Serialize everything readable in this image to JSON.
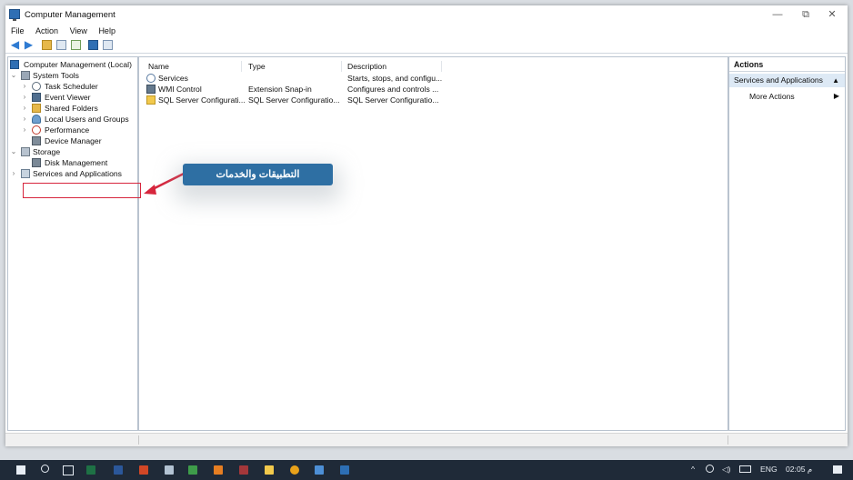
{
  "window": {
    "title": "Computer Management",
    "minimize": "—",
    "restore": "⧉",
    "close": "✕"
  },
  "menu": [
    "File",
    "Action",
    "View",
    "Help"
  ],
  "tree": {
    "root": "Computer Management (Local)",
    "items": [
      "System Tools",
      "Task Scheduler",
      "Event Viewer",
      "Shared Folders",
      "Local Users and Groups",
      "Performance",
      "Device Manager",
      "Storage",
      "Disk Management",
      "Services and Applications"
    ]
  },
  "list": {
    "columns": [
      "Name",
      "Type",
      "Description"
    ],
    "rows": [
      {
        "name": "Services",
        "type": "",
        "description": "Starts, stops, and configu..."
      },
      {
        "name": "WMI Control",
        "type": "Extension Snap-in",
        "description": "Configures and controls ..."
      },
      {
        "name": "SQL Server Configurati...",
        "type": "SQL Server Configuratio...",
        "description": "SQL Server Configuratio..."
      }
    ]
  },
  "actions": {
    "title": "Actions",
    "section": "Services and Applications",
    "item": "More Actions"
  },
  "annotation": {
    "label": "التطبيقات والخدمات"
  },
  "taskbar": {
    "lang": "ENG",
    "time": "02:05 م"
  },
  "colors": {
    "accent": "#2e6fa3",
    "highlight": "#d7263d",
    "taskbar": "#1f2a38"
  }
}
